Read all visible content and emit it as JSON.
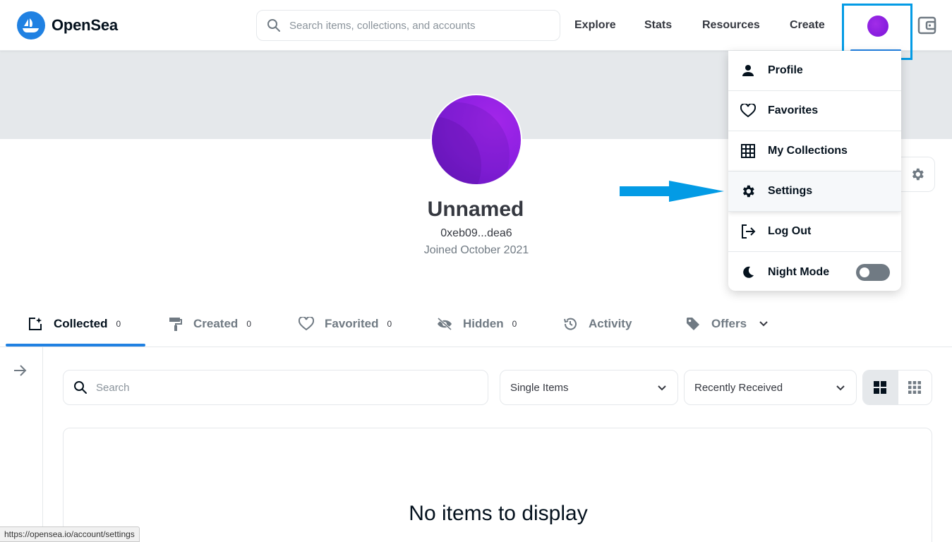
{
  "brand": {
    "name": "OpenSea",
    "color": "#2081e2"
  },
  "header": {
    "search_placeholder": "Search items, collections, and accounts",
    "nav": {
      "explore": "Explore",
      "stats": "Stats",
      "resources": "Resources",
      "create": "Create"
    }
  },
  "profile": {
    "name": "Unnamed",
    "address": "0xeb09...dea6",
    "joined": "Joined October 2021"
  },
  "dropdown": {
    "items": [
      {
        "label": "Profile",
        "icon": "person-icon"
      },
      {
        "label": "Favorites",
        "icon": "heart-icon"
      },
      {
        "label": "My Collections",
        "icon": "grid-icon"
      },
      {
        "label": "Settings",
        "icon": "gear-icon"
      },
      {
        "label": "Log Out",
        "icon": "logout-icon"
      },
      {
        "label": "Night Mode",
        "icon": "moon-icon",
        "toggle": false
      }
    ]
  },
  "tabs": [
    {
      "label": "Collected",
      "count": "0"
    },
    {
      "label": "Created",
      "count": "0"
    },
    {
      "label": "Favorited",
      "count": "0"
    },
    {
      "label": "Hidden",
      "count": "0"
    },
    {
      "label": "Activity"
    },
    {
      "label": "Offers"
    }
  ],
  "filters": {
    "search_placeholder": "Search",
    "item_type": "Single Items",
    "sort": "Recently Received"
  },
  "empty_message": "No items to display",
  "status_url": "https://opensea.io/account/settings",
  "colors": {
    "accent": "#2081e2",
    "annotation": "#039be5",
    "avatar": "#8a1fe0"
  }
}
